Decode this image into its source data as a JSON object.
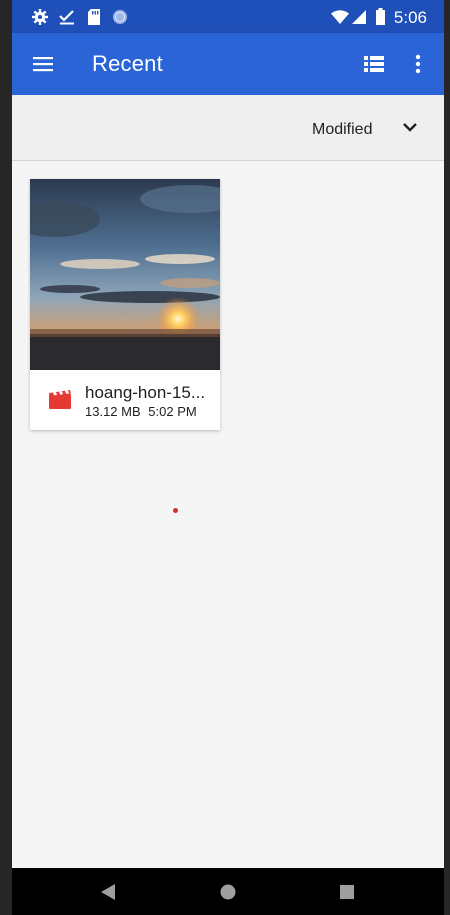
{
  "status_bar": {
    "time": "5:06",
    "icons": [
      "gear-icon",
      "check-icon",
      "sd-card-icon",
      "circle-icon",
      "wifi-icon",
      "signal-icon",
      "battery-icon"
    ]
  },
  "app_bar": {
    "title": "Recent",
    "icons": [
      "menu-icon",
      "list-view-icon",
      "more-vert-icon"
    ]
  },
  "sort_bar": {
    "label": "Modified",
    "icon": "chevron-down-icon"
  },
  "files": [
    {
      "name": "hoang-hon-15...",
      "size": "13.12 MB",
      "time": "5:02 PM",
      "type_icon": "video-file-icon",
      "thumbnail": "sunset-thumbnail"
    }
  ],
  "nav_bar": {
    "icons": [
      "back-icon",
      "home-icon",
      "recents-icon"
    ]
  },
  "colors": {
    "status_bar": "#1f4fb8",
    "app_bar": "#2a64d6",
    "background": "#f5f5f5",
    "video_icon": "#e53935"
  }
}
